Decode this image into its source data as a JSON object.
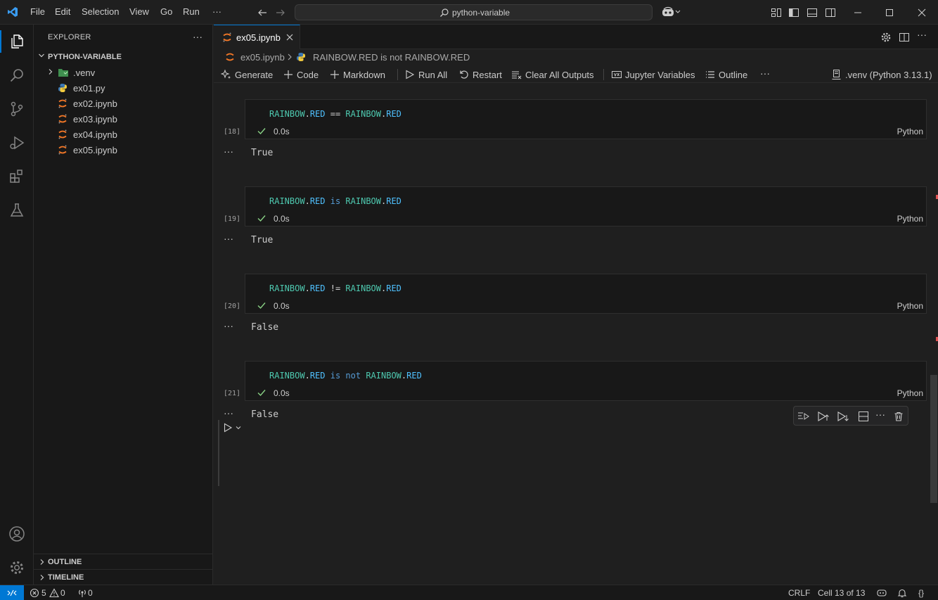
{
  "menu": {
    "file": "File",
    "edit": "Edit",
    "selection": "Selection",
    "view": "View",
    "go": "Go",
    "run": "Run",
    "more": "···"
  },
  "search": {
    "label": "python-variable"
  },
  "explorer": {
    "title": "EXPLORER",
    "more": "···",
    "folder": "PYTHON-VARIABLE",
    "items": [
      {
        "label": ".venv",
        "icon": "folder-icon"
      },
      {
        "label": "ex01.py",
        "icon": "python-icon"
      },
      {
        "label": "ex02.ipynb",
        "icon": "jupyter-icon"
      },
      {
        "label": "ex03.ipynb",
        "icon": "jupyter-icon"
      },
      {
        "label": "ex04.ipynb",
        "icon": "jupyter-icon"
      },
      {
        "label": "ex05.ipynb",
        "icon": "jupyter-icon"
      }
    ],
    "outline": "OUTLINE",
    "timeline": "TIMELINE"
  },
  "tab": {
    "label": "ex05.ipynb"
  },
  "breadcrumb": {
    "file": "ex05.ipynb",
    "cell": "RAINBOW.RED is not RAINBOW.RED"
  },
  "toolbar": {
    "generate": "Generate",
    "code": "Code",
    "markdown": "Markdown",
    "run_all": "Run All",
    "restart": "Restart",
    "clear_outputs": "Clear All Outputs",
    "jupyter_variables": "Jupyter Variables",
    "outline": "Outline",
    "more": "···",
    "kernel": ".venv (Python 3.13.1)"
  },
  "cells": [
    {
      "count": "[18]",
      "var1": "RAINBOW",
      "attr1": "RED",
      "op": "==",
      "var2": "RAINBOW",
      "attr2": "RED",
      "time": "0.0s",
      "lang": "Python",
      "output": "True"
    },
    {
      "count": "[19]",
      "var1": "RAINBOW",
      "attr1": "RED",
      "op": "is",
      "var2": "RAINBOW",
      "attr2": "RED",
      "time": "0.0s",
      "lang": "Python",
      "output": "True"
    },
    {
      "count": "[20]",
      "var1": "RAINBOW",
      "attr1": "RED",
      "op": "!=",
      "var2": "RAINBOW",
      "attr2": "RED",
      "time": "0.0s",
      "lang": "Python",
      "output": "False"
    },
    {
      "count": "[21]",
      "var1": "RAINBOW",
      "attr1": "RED",
      "op": "is not",
      "var2": "RAINBOW",
      "attr2": "RED",
      "time": "0.0s",
      "lang": "Python",
      "output": "False"
    }
  ],
  "output_more": "···",
  "status": {
    "errors": "5",
    "warnings": "0",
    "ports": "0",
    "eol": "CRLF",
    "cell_pos": "Cell 13 of 13",
    "braces": "{}"
  },
  "colors": {
    "accent": "#0078d4",
    "success": "#89d185",
    "keyword": "#569cd6",
    "class": "#4ec9b0",
    "attribute": "#4fc1ff"
  }
}
